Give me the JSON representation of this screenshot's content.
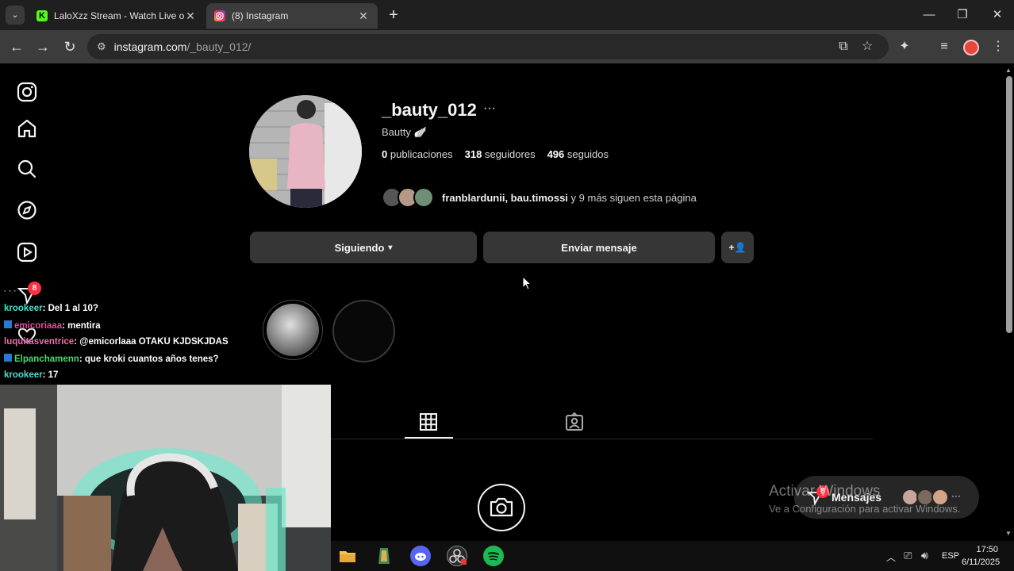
{
  "browser": {
    "tabs": [
      {
        "title": "LaloXzz Stream - Watch Live on",
        "favicon": "K",
        "favicon_color": "#53fc18"
      },
      {
        "title": "(8) Instagram",
        "favicon": "instagram"
      }
    ],
    "new_tab_symbol": "+",
    "url_domain": "instagram.com",
    "url_path": "/_bauty_012/"
  },
  "profile": {
    "username": "_bauty_012",
    "more_symbol": "···",
    "full_name": "Bautty 🪽",
    "posts_count": "0",
    "posts_label": "publicaciones",
    "followers_count": "318",
    "followers_label": "seguidores",
    "following_count": "496",
    "following_label": "seguidos",
    "followed_by_names": "franblardunii, bau.timossi",
    "followed_by_rest": "y 9 más siguen esta página",
    "following_button": "Siguiendo",
    "message_button": "Enviar mensaje"
  },
  "sidebar": {
    "notification_badge": "8"
  },
  "stream_chat": [
    {
      "user": "krookeer",
      "user_color": "#4fdfd0",
      "text": ": Del 1 al 10?",
      "badge": false
    },
    {
      "user": "emicoriaaa",
      "user_color": "#e04e9a",
      "text": ": mentira",
      "badge": true
    },
    {
      "user": "luquitasventrice",
      "user_color": "#f06dad",
      "text": ": @emicorlaaa OTAKU KJDSKJDAS",
      "badge": false
    },
    {
      "user": "Elpanchamenn",
      "user_color": "#53d769",
      "text": ": que kroki cuantos años tenes?",
      "badge": true
    },
    {
      "user": "krookeer",
      "user_color": "#4fdfd0",
      "text": ": 17",
      "badge": false
    }
  ],
  "messages": {
    "label": "Mensajes",
    "badge": "8",
    "more_symbol": "···"
  },
  "watermark": {
    "line1": "Activar Windows",
    "line2": "Ve a Configuración para activar Windows."
  },
  "taskbar": {
    "language": "ESP",
    "time": "17:50",
    "date": "6/11/2025"
  }
}
